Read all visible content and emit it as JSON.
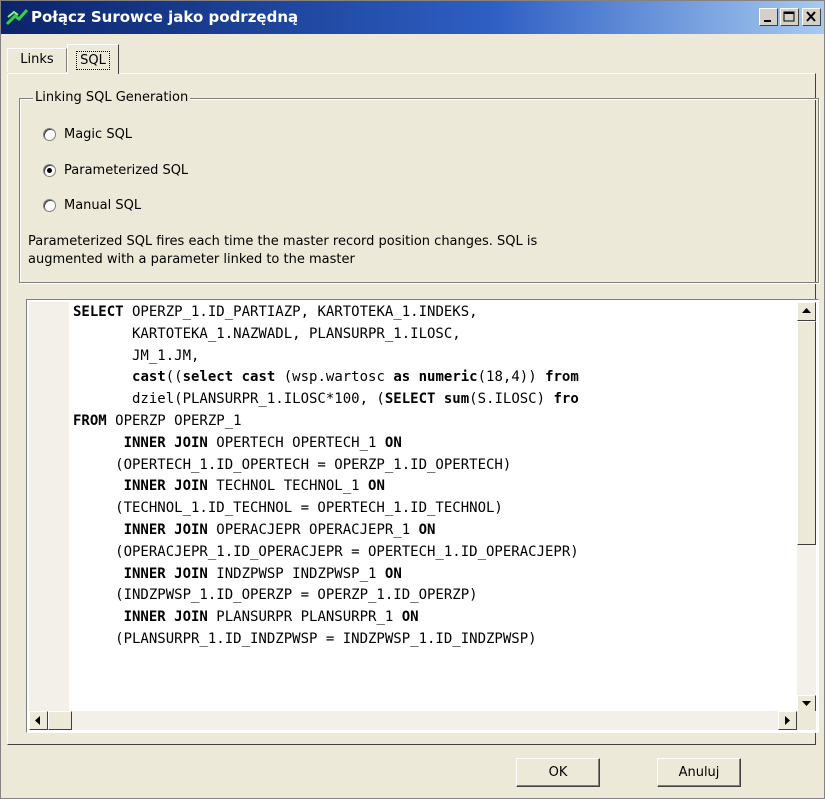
{
  "window": {
    "title": "Połącz Surowce jako podrzędną"
  },
  "tabs": [
    {
      "label": "Links",
      "selected": false
    },
    {
      "label": "SQL",
      "selected": true
    }
  ],
  "group": {
    "legend": "Linking SQL Generation",
    "options": [
      {
        "label": "Magic SQL",
        "checked": false
      },
      {
        "label": "Parameterized SQL",
        "checked": true
      },
      {
        "label": "Manual SQL",
        "checked": false
      }
    ],
    "description_line1": "Parameterized SQL fires each time the master record position changes. SQL is",
    "description_line2": "augmented with a parameter linked to the master"
  },
  "sql_lines": [
    [
      {
        "t": "SELECT",
        "b": true
      },
      {
        "t": " OPERZP_1.ID_PARTIAZP, KARTOTEKA_1.INDEKS,"
      }
    ],
    [
      {
        "t": "       KARTOTEKA_1.NAZWADL, PLANSURPR_1.ILOSC,"
      }
    ],
    [
      {
        "t": "       JM_1.JM,"
      }
    ],
    [
      {
        "t": "       "
      },
      {
        "t": "cast",
        "b": true
      },
      {
        "t": "(("
      },
      {
        "t": "select cast",
        "b": true
      },
      {
        "t": " (wsp.wartosc "
      },
      {
        "t": "as numeric",
        "b": true
      },
      {
        "t": "(18,4)) "
      },
      {
        "t": "from",
        "b": true
      }
    ],
    [
      {
        "t": "       dziel(PLANSURPR_1.ILOSC*100, ("
      },
      {
        "t": "SELECT sum",
        "b": true
      },
      {
        "t": "(S.ILOSC) "
      },
      {
        "t": "fro",
        "b": true
      }
    ],
    [
      {
        "t": "FROM",
        "b": true
      },
      {
        "t": " OPERZP OPERZP_1"
      }
    ],
    [
      {
        "t": "      "
      },
      {
        "t": "INNER JOIN",
        "b": true
      },
      {
        "t": " OPERTECH OPERTECH_1 "
      },
      {
        "t": "ON",
        "b": true
      }
    ],
    [
      {
        "t": "     (OPERTECH_1.ID_OPERTECH = OPERZP_1.ID_OPERTECH)"
      }
    ],
    [
      {
        "t": "      "
      },
      {
        "t": "INNER JOIN",
        "b": true
      },
      {
        "t": " TECHNOL TECHNOL_1 "
      },
      {
        "t": "ON",
        "b": true
      }
    ],
    [
      {
        "t": "     (TECHNOL_1.ID_TECHNOL = OPERTECH_1.ID_TECHNOL)"
      }
    ],
    [
      {
        "t": "      "
      },
      {
        "t": "INNER JOIN",
        "b": true
      },
      {
        "t": " OPERACJEPR OPERACJEPR_1 "
      },
      {
        "t": "ON",
        "b": true
      }
    ],
    [
      {
        "t": "     (OPERACJEPR_1.ID_OPERACJEPR = OPERTECH_1.ID_OPERACJEPR)"
      }
    ],
    [
      {
        "t": "      "
      },
      {
        "t": "INNER JOIN",
        "b": true
      },
      {
        "t": " INDZPWSP INDZPWSP_1 "
      },
      {
        "t": "ON",
        "b": true
      }
    ],
    [
      {
        "t": "     (INDZPWSP_1.ID_OPERZP = OPERZP_1.ID_OPERZP)"
      }
    ],
    [
      {
        "t": "      "
      },
      {
        "t": "INNER JOIN",
        "b": true
      },
      {
        "t": " PLANSURPR PLANSURPR_1 "
      },
      {
        "t": "ON",
        "b": true
      }
    ],
    [
      {
        "t": "     (PLANSURPR_1.ID_INDZPWSP = INDZPWSP_1.ID_INDZPWSP)"
      }
    ]
  ],
  "buttons": {
    "ok": "OK",
    "cancel": "Anuluj"
  },
  "icons": {
    "title": "link-icon",
    "minimize": "minimize-icon",
    "maximize": "maximize-icon",
    "close": "close-icon"
  }
}
